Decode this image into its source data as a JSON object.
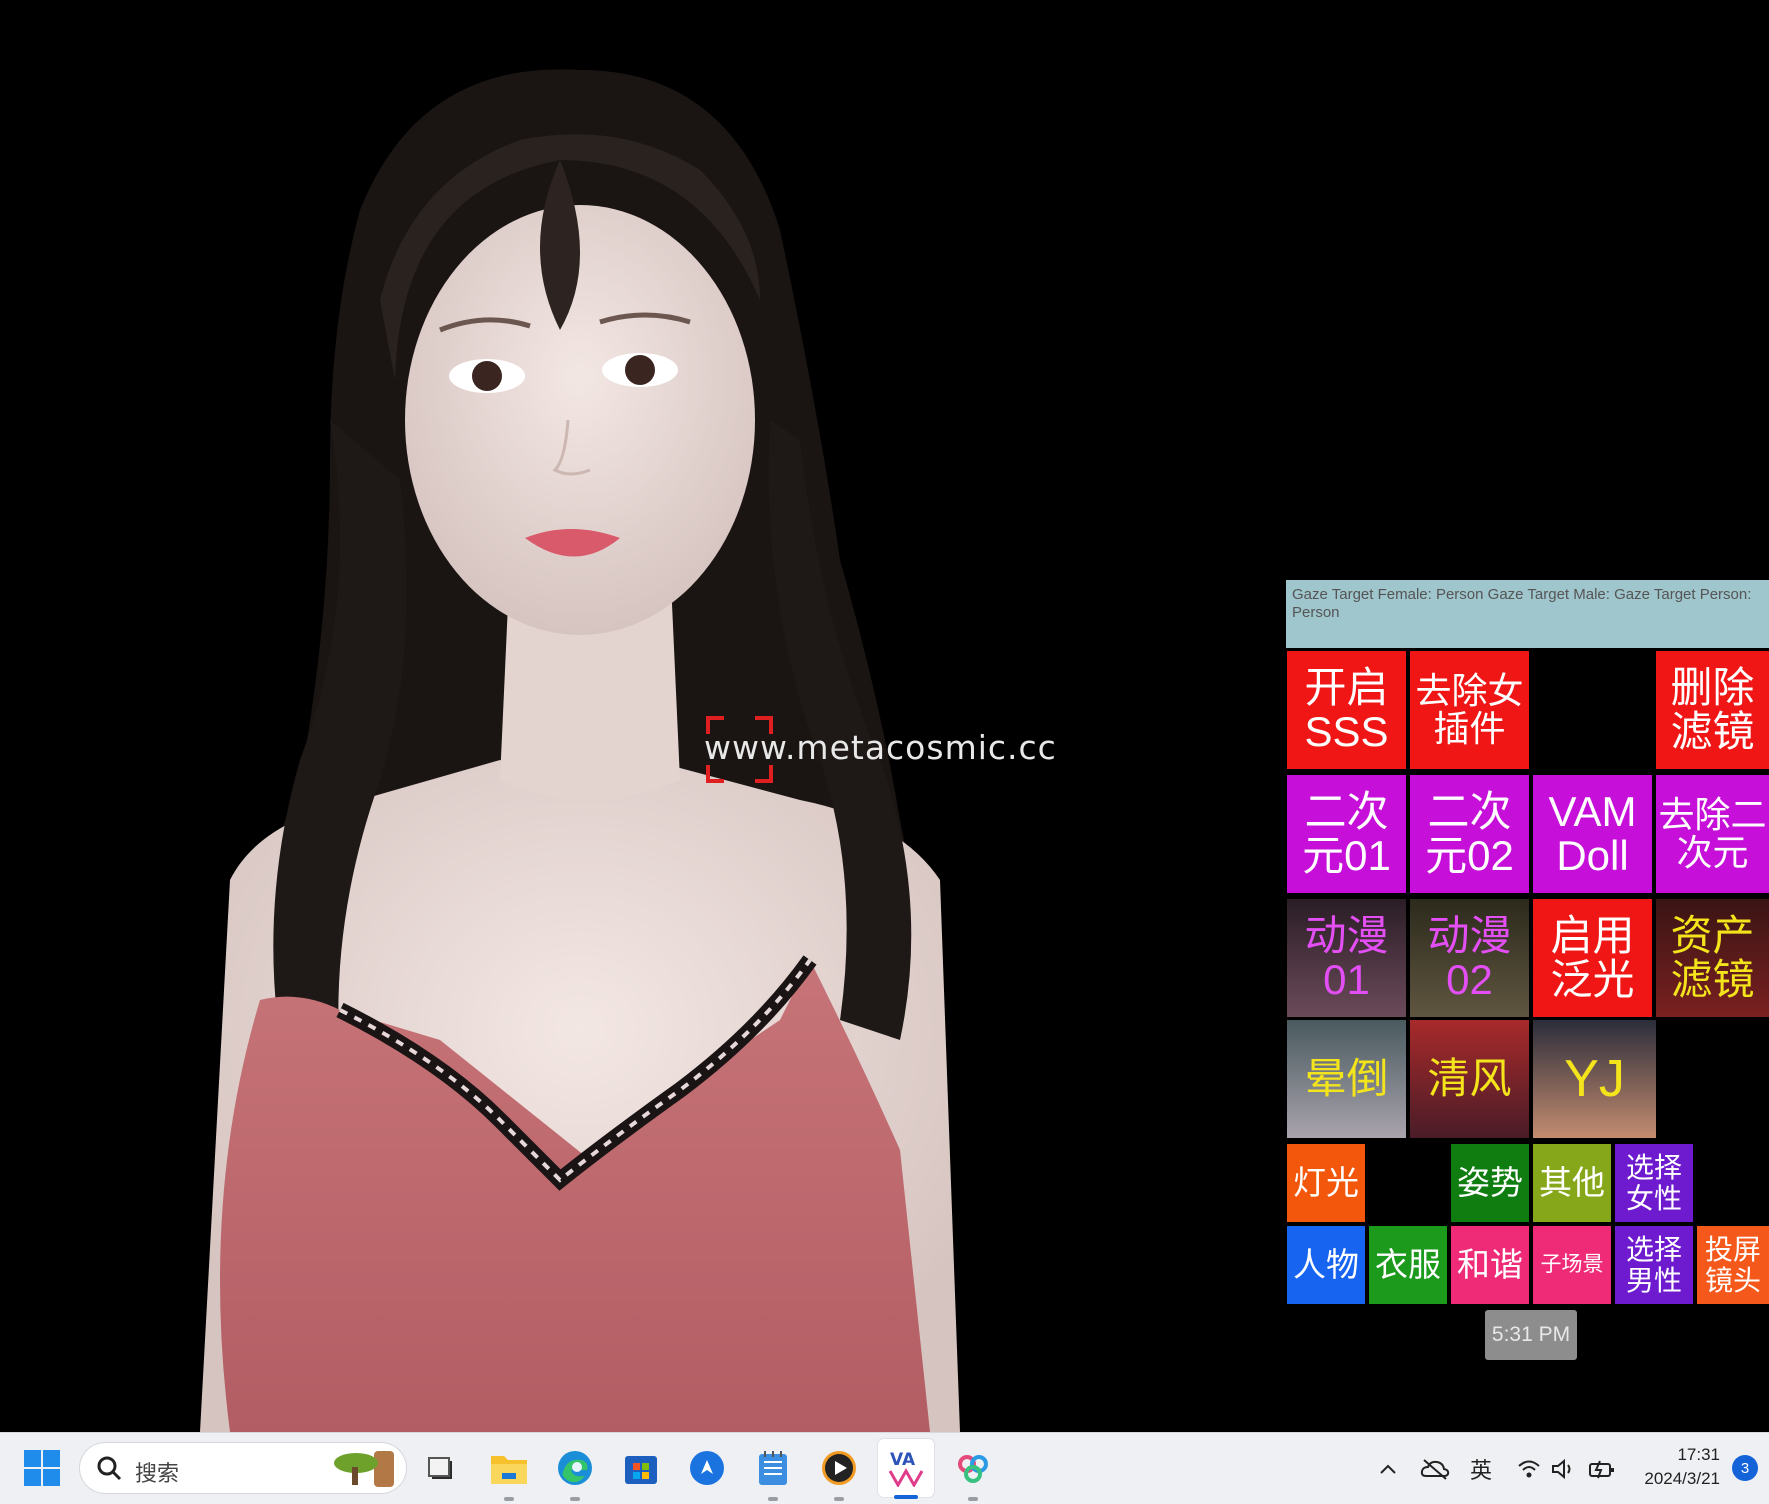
{
  "scene": {
    "watermark": "www.metacosmic.cc",
    "gaze_text": "Gaze Target Female: Person Gaze Target Male: Gaze Target Person: Person",
    "time_chip": "5:31 PM"
  },
  "tiles": {
    "row1": [
      "开启\nSSS",
      "去除女\n插件",
      "删除\n滤镜"
    ],
    "row2": [
      "二次\n元01",
      "二次\n元02",
      "VAM\nDoll",
      "去除二\n次元"
    ],
    "row3": [
      "动漫\n01",
      "动漫\n02",
      "启用\n泛光",
      "资产\n滤镜"
    ],
    "row4": [
      "晕倒",
      "清风",
      "YJ"
    ],
    "row5": [
      "灯光",
      "姿势",
      "其他",
      "选择\n女性"
    ],
    "row6": [
      "人物",
      "衣服",
      "和谐",
      "子场景",
      "选择\n男性",
      "投屏\n镜头"
    ]
  },
  "taskbar": {
    "search_placeholder": "搜索",
    "apps": [
      "file-explorer",
      "edge",
      "microsoft-store",
      "app-blue",
      "notepad",
      "media-player",
      "vam",
      "app-multicolor"
    ],
    "ime": "英",
    "time": "17:31",
    "date": "2024/3/21",
    "notification_count": "3"
  },
  "colors": {
    "red": "#f01616",
    "purple": "#c60fd9",
    "orange": "#f2570c",
    "green": "#0f7d10",
    "blue": "#1764f0",
    "pink": "#ef2b78",
    "violet": "#6e1bcf",
    "accent": "#1463d9"
  }
}
